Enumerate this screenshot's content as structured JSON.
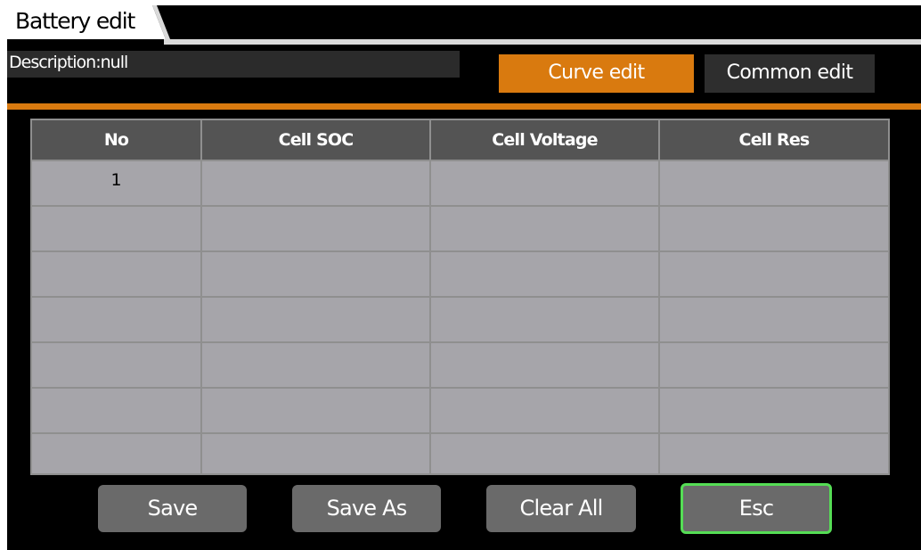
{
  "window": {
    "title": "Battery edit"
  },
  "description": {
    "text": "Description:null"
  },
  "tabs": [
    {
      "label": "Curve edit",
      "active": true
    },
    {
      "label": "Common edit",
      "active": false
    }
  ],
  "table": {
    "headers": [
      "No",
      "Cell SOC",
      "Cell Voltage",
      "Cell Res"
    ],
    "rows": [
      [
        "1",
        "",
        "",
        ""
      ],
      [
        "",
        "",
        "",
        ""
      ],
      [
        "",
        "",
        "",
        ""
      ],
      [
        "",
        "",
        "",
        ""
      ],
      [
        "",
        "",
        "",
        ""
      ],
      [
        "",
        "",
        "",
        ""
      ],
      [
        "",
        "",
        "",
        ""
      ]
    ]
  },
  "buttons": {
    "save": "Save",
    "save_as": "Save As",
    "clear_all": "Clear All",
    "esc": "Esc"
  },
  "colors": {
    "accent": "#d97a0f",
    "focus": "#55dd55",
    "background": "#000000"
  }
}
